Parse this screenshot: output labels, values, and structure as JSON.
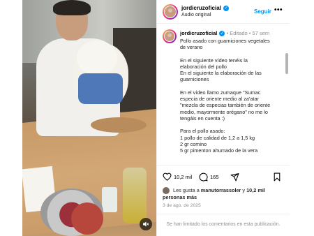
{
  "header": {
    "username": "jordicruzoficial",
    "audio": "Audio original",
    "follow_label": "Seguir",
    "more_icon": "more-horizontal-icon"
  },
  "post": {
    "username": "jordicruzoficial",
    "edited": "Editado",
    "separator": "•",
    "time": "57 sem",
    "caption_lines": [
      [
        "Pollo asado con guarniciones vegetales",
        "de verano"
      ],
      [
        "En el siguiente vídeo tenéis la",
        "elaboración del pollo",
        "En el siguiente la elaboración de las",
        "guarniciones"
      ],
      [
        "En el vídeo llamo zumaque \"Sumac",
        "especia de oriente medio al za'atar",
        "\"mezcla de especias también de oriente",
        "medio, mayormente orégano\" no me lo",
        "tengáis en cuenta :)"
      ],
      [
        "Para el pollo asado:",
        "1 pollo de calidad de 1,2 a 1,5 kg",
        "2 gr comino",
        "5 gr pimenton ahumado de la vera"
      ]
    ]
  },
  "actions": {
    "likes_count": "10,2 mil",
    "comments_count": "165",
    "like_icon": "heart-icon",
    "comment_icon": "comment-icon",
    "share_icon": "send-icon",
    "save_icon": "bookmark-icon"
  },
  "likes": {
    "prefix": "Les gusta a",
    "user": "manutorrassoler",
    "joiner": "y",
    "count": "10,2 mil",
    "suffix": "personas más"
  },
  "date": "3 de ago. de 2025",
  "comments_limited": "Se han limitado los comentarios en esta publicación."
}
